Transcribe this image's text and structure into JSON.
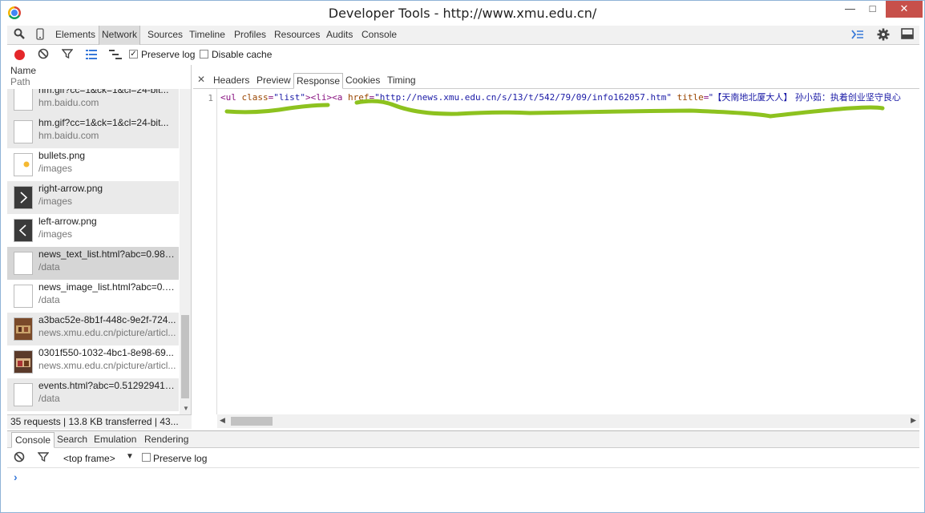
{
  "window": {
    "title": "Developer Tools - http://www.xmu.edu.cn/",
    "minimize_glyph": "—",
    "maximize_glyph": "□",
    "close_glyph": "✕"
  },
  "toolbar": {
    "panels": [
      "Elements",
      "Network",
      "Sources",
      "Timeline",
      "Profiles",
      "Resources",
      "Audits",
      "Console"
    ],
    "active_panel": "Network"
  },
  "network_toolbar": {
    "preserve_log_label": "Preserve log",
    "preserve_log_checked": true,
    "disable_cache_label": "Disable cache",
    "disable_cache_checked": false
  },
  "request_list": {
    "header_name": "Name",
    "header_path": "Path",
    "rows": [
      {
        "name": "hm.gif?cc=1&ck=1&cl=24-bit...",
        "path": "hm.baidu.com",
        "icon": "blank-file-icon"
      },
      {
        "name": "hm.gif?cc=1&ck=1&cl=24-bit...",
        "path": "hm.baidu.com",
        "icon": "blank-file-icon"
      },
      {
        "name": "bullets.png",
        "path": "/images",
        "icon": "bullet-image-icon"
      },
      {
        "name": "right-arrow.png",
        "path": "/images",
        "icon": "right-arrow-image-icon"
      },
      {
        "name": "left-arrow.png",
        "path": "/images",
        "icon": "left-arrow-image-icon"
      },
      {
        "name": "news_text_list.html?abc=0.982...",
        "path": "/data",
        "icon": "blank-file-icon"
      },
      {
        "name": "news_image_list.html?abc=0.0...",
        "path": "/data",
        "icon": "blank-file-icon"
      },
      {
        "name": "a3bac52e-8b1f-448c-9e2f-724...",
        "path": "news.xmu.edu.cn/picture/articl...",
        "icon": "photo-thumbnail-icon"
      },
      {
        "name": "0301f550-1032-4bc1-8e98-69...",
        "path": "news.xmu.edu.cn/picture/articl...",
        "icon": "photo-thumbnail-icon"
      },
      {
        "name": "events.html?abc=0.512929413...",
        "path": "/data",
        "icon": "blank-file-icon"
      }
    ]
  },
  "status": {
    "text": "35 requests  |  13.8 KB transferred  |  43..."
  },
  "detail": {
    "tabs": [
      "Headers",
      "Preview",
      "Response",
      "Cookies",
      "Timing"
    ],
    "active_tab": "Response",
    "line_number": "1",
    "code": {
      "p1": "<ul ",
      "a1": "class",
      "p2": "=",
      "v1": "\"list\"",
      "p3": "><li><a ",
      "a2": "href",
      "p4": "=",
      "v2": "\"http://news.xmu.edu.cn/s/13/t/542/79/09/info162057.htm\"",
      "p5": " ",
      "a3": "title",
      "p6": "=",
      "v3": "\"【天南地北厦大人】 孙小茹：执着创业坚守良心"
    }
  },
  "drawer": {
    "tabs": [
      "Console",
      "Search",
      "Emulation",
      "Rendering"
    ],
    "active_tab": "Console",
    "frame_select": "<top frame>",
    "preserve_log_label": "Preserve log",
    "prompt": "›"
  },
  "colors": {
    "record": "#e4272a",
    "annotation": "#8dc21f",
    "close_button": "#c7504a"
  }
}
